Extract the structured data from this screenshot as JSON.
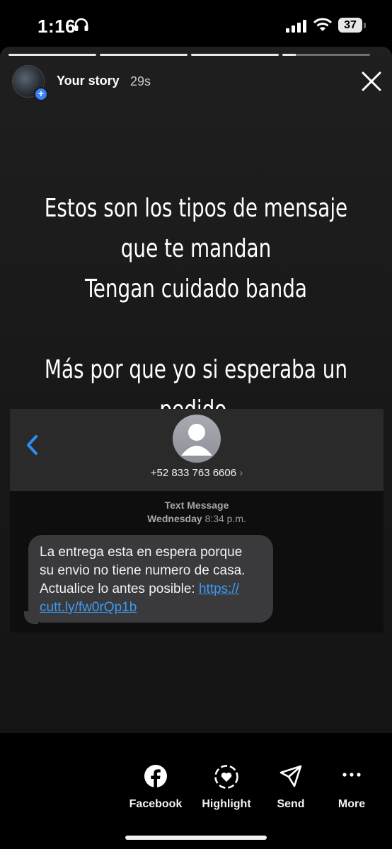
{
  "status_bar": {
    "time": "1:16",
    "battery": "37"
  },
  "story": {
    "user_label": "Your story",
    "elapsed": "29s",
    "progress_fractions": [
      1,
      1,
      1,
      0.15
    ],
    "caption_lines": [
      "Estos son los tipos de mensaje",
      "que te mandan",
      "Tengan cuidado banda",
      "",
      "Más por que yo si esperaba un",
      "pedido."
    ]
  },
  "sms": {
    "contact_number": "+52 833 763 6606",
    "label": "Text Message",
    "date_day": "Wednesday",
    "date_time": "8:34 p.m.",
    "message_lines": [
      "La entrega esta en espera porque",
      "su envio no tiene numero de casa.",
      "Actualice lo antes posible: "
    ],
    "link_part1": "https://",
    "link_part2": "cutt.ly/fw0rQp1b"
  },
  "actions": [
    {
      "label": "Facebook",
      "icon": "facebook-icon"
    },
    {
      "label": "Highlight",
      "icon": "highlight-heart-icon"
    },
    {
      "label": "Send",
      "icon": "send-icon"
    },
    {
      "label": "More",
      "icon": "more-dots-icon"
    }
  ],
  "colors": {
    "link": "#3b9af5",
    "bubble": "#3a3a3c",
    "accent_blue": "#3b82f6"
  }
}
